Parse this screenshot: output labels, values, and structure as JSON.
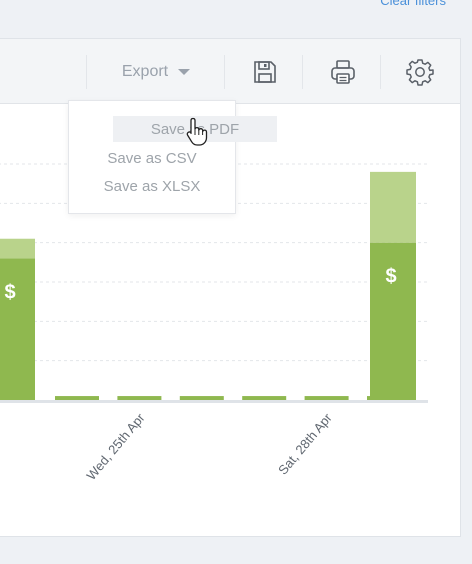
{
  "header": {
    "clear_filters_label": "Clear filters"
  },
  "toolbar": {
    "export_label": "Export",
    "icons": [
      "save-icon",
      "print-icon",
      "settings-gear-icon"
    ]
  },
  "export_menu": {
    "items": [
      {
        "label": "Save as PDF",
        "hovered": true
      },
      {
        "label": "Save as CSV",
        "hovered": false
      },
      {
        "label": "Save as XLSX",
        "hovered": false
      }
    ]
  },
  "colors": {
    "bar_dark": "#8fb84f",
    "bar_light": "#b9d38b",
    "axis": "#dfe3e8",
    "grid": "#e3e6ea",
    "text_muted": "#9aa2ac",
    "link": "#4a90d9"
  },
  "chart_data": {
    "type": "bar",
    "categories": [
      "",
      "",
      "Wed, 25th Apr",
      "",
      "",
      "Sat, 28th Apr",
      "",
      ""
    ],
    "x_tick_labels": [
      "Wed, 25th Apr",
      "Sat, 28th Apr"
    ],
    "series": [
      {
        "values": [
          3.6,
          0.1,
          0.1,
          0.1,
          0.1,
          0.1,
          0.1,
          4.0
        ]
      },
      {
        "values": [
          0.5,
          0,
          0,
          0,
          0,
          0,
          0,
          1.8
        ]
      }
    ],
    "bar_symbol": "$",
    "ylim": [
      0,
      6
    ],
    "grid": true,
    "title": "",
    "xlabel": "",
    "ylabel": ""
  }
}
